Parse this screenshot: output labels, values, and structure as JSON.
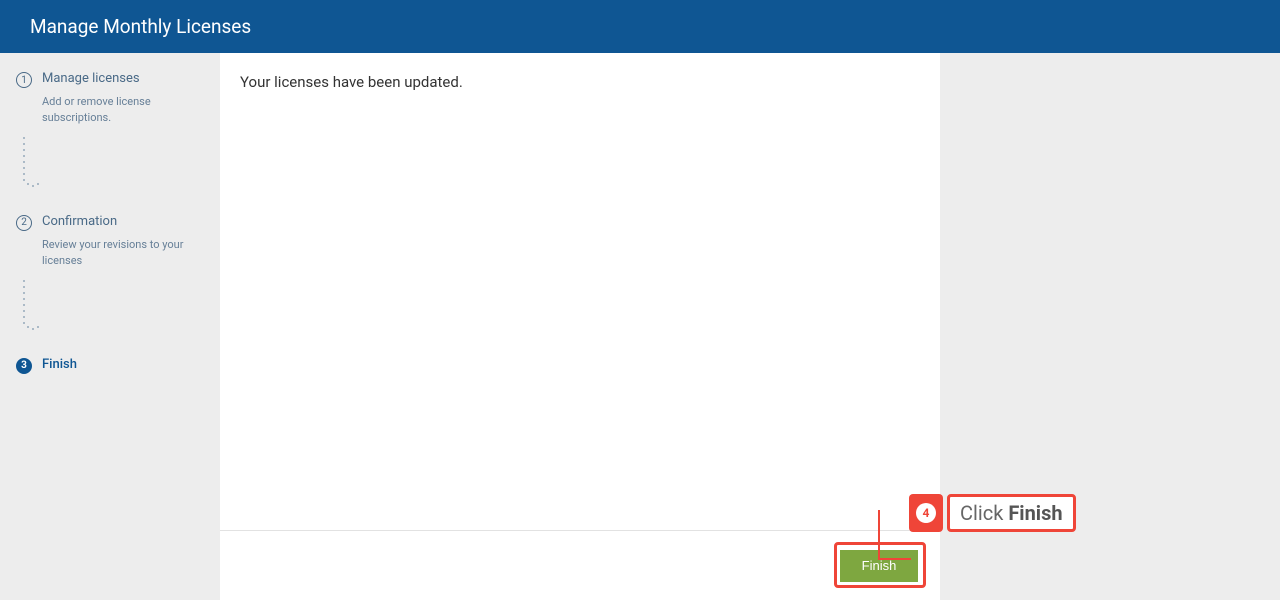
{
  "header": {
    "title": "Manage Monthly Licenses"
  },
  "sidebar": {
    "steps": [
      {
        "num": "1",
        "title": "Manage licenses",
        "desc": "Add or remove license subscriptions."
      },
      {
        "num": "2",
        "title": "Confirmation",
        "desc": "Review your revisions to your licenses"
      },
      {
        "num": "3",
        "title": "Finish",
        "desc": ""
      }
    ]
  },
  "main": {
    "message": "Your licenses have been updated."
  },
  "footer": {
    "finish_label": "Finish"
  },
  "annotation": {
    "badge_num": "4",
    "text_prefix": "Click ",
    "text_bold": "Finish"
  }
}
